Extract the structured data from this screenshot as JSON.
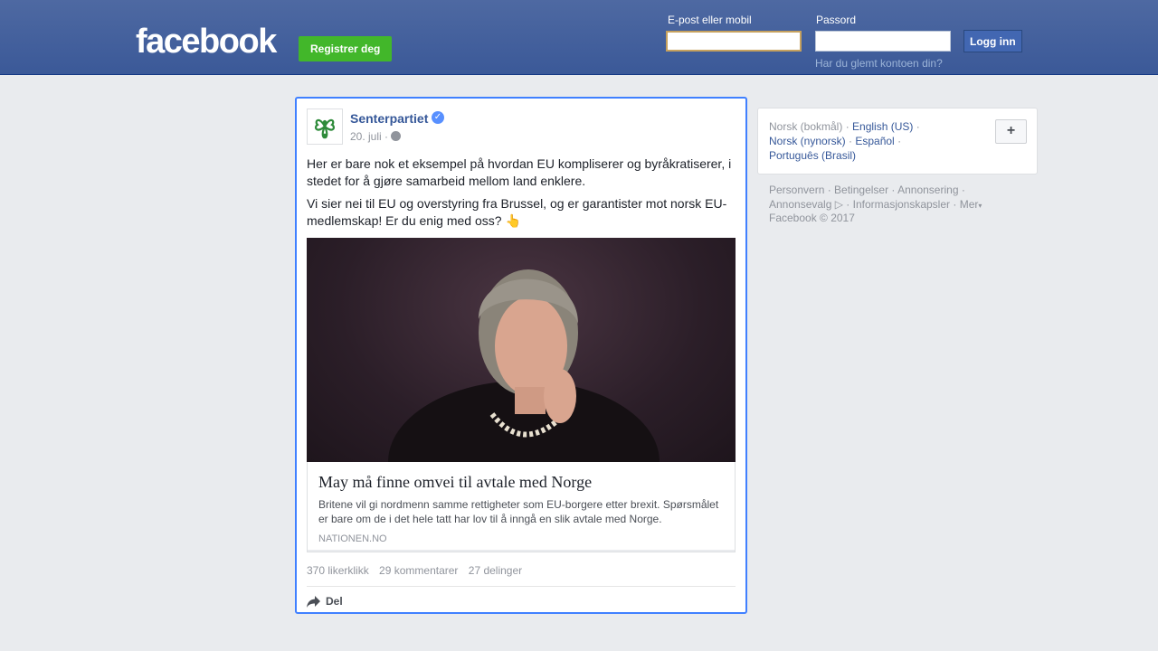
{
  "header": {
    "logo": "facebook",
    "register_label": "Registrer deg",
    "email_label": "E-post eller mobil",
    "email_value": "",
    "password_label": "Passord",
    "password_value": "",
    "login_label": "Logg inn",
    "forgot_label": "Har du glemt kontoen din?"
  },
  "post": {
    "page_name": "Senterpartiet",
    "verified_icon": "verified-badge-icon",
    "date": "20. juli ·",
    "privacy_icon": "globe-icon",
    "paragraph1": "Her er bare nok et eksempel på hvordan EU kompliserer og byråkratiserer, i stedet for å gjøre samarbeid mellom land enklere.",
    "paragraph2": "Vi sier nei til EU og overstyring fra Brussel, og er garantister mot norsk EU-medlemskap! Er du enig med oss?",
    "emoji": "👆",
    "link": {
      "title": "May må finne omvei til avtale med Norge",
      "description": "Britene vil gi nordmenn samme rettigheter som EU-borgere etter brexit. Spørsmålet er bare om de i det hele tatt har lov til å inngå en slik avtale med Norge.",
      "domain": "NATIONEN.NO"
    },
    "likes": "370 likerklikk",
    "comments": "29 kommentarer",
    "shares": "27 delinger",
    "share_label": "Del"
  },
  "languages": {
    "current": "Norsk (bokmål)",
    "english": "English (US)",
    "nynorsk": "Norsk (nynorsk)",
    "spanish": "Español",
    "portuguese": "Português (Brasil)",
    "plus_label": "+"
  },
  "footer": {
    "privacy": "Personvern",
    "terms": "Betingelser",
    "ads": "Annonsering",
    "adchoices": "Annonsevalg",
    "cookies": "Informasjonskapsler",
    "more": "Mer",
    "copyright": "Facebook © 2017"
  },
  "colors": {
    "header_bg": "#3b5998",
    "link": "#365899",
    "register_green": "#42b72a",
    "focus_border": "#4080ff"
  }
}
